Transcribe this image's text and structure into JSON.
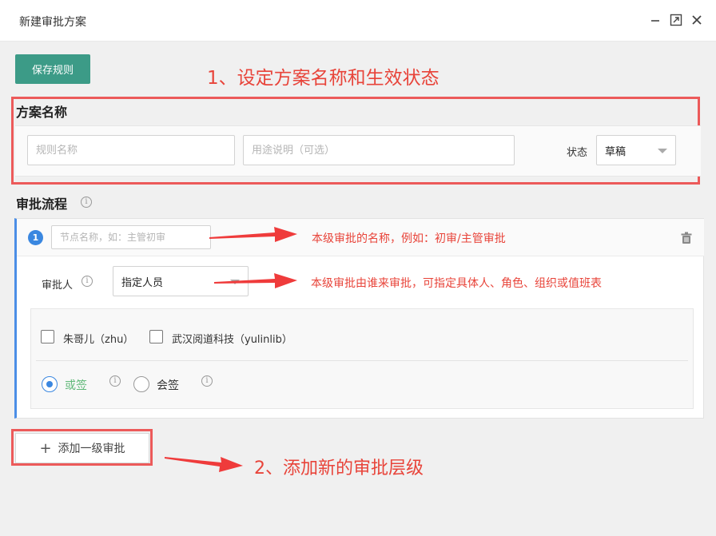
{
  "window": {
    "title": "新建审批方案"
  },
  "toolbar": {
    "save_label": "保存规则"
  },
  "annotations": {
    "a1": "1、设定方案名称和生效状态",
    "a2": "本级审批的名称，例如：初审/主管审批",
    "a3": "本级审批由谁来审批，可指定具体人、角色、组织或值班表",
    "a4": "2、添加新的审批层级"
  },
  "scheme": {
    "title": "方案名称",
    "name_placeholder": "规则名称",
    "purpose_placeholder": "用途说明（可选）",
    "status_label": "状态",
    "status_value": "草稿"
  },
  "flow": {
    "title": "审批流程",
    "step_number": "1",
    "node_placeholder": "节点名称，如：主管初审",
    "approver_label": "审批人",
    "approver_type": "指定人员",
    "approvers": [
      {
        "name": "朱哥儿（zhu）",
        "checked": false
      },
      {
        "name": "武汉阅道科技（yulinlib）",
        "checked": false
      }
    ],
    "modes": [
      {
        "label": "或签",
        "selected": true
      },
      {
        "label": "会签",
        "selected": false
      }
    ],
    "add_level_label": "添加一级审批"
  },
  "colors": {
    "primary": "#3c9b87",
    "accent_blue": "#3a87e0",
    "annotation_red": "#e8443a",
    "mode_selected_green": "#5fb878"
  }
}
